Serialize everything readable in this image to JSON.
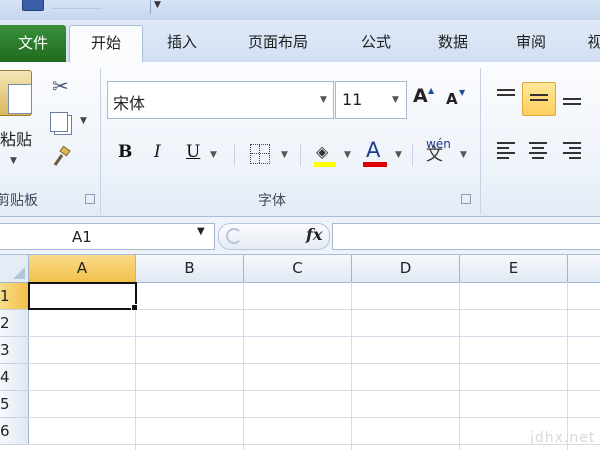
{
  "tabs": {
    "file": "文件",
    "items": [
      "开始",
      "插入",
      "页面布局",
      "公式",
      "数据",
      "审阅",
      "视"
    ]
  },
  "ribbon": {
    "clipboard": {
      "paste_label": "粘贴",
      "group_label": "剪贴板"
    },
    "font": {
      "font_name": "宋体",
      "font_size": "11",
      "grow_label": "A",
      "shrink_label": "A",
      "bold": "B",
      "italic": "I",
      "underline": "U",
      "font_color_label": "A",
      "phonetic_top": "wén",
      "phonetic_char": "文",
      "group_label": "字体"
    }
  },
  "formula_bar": {
    "name_box": "A1",
    "fx_label": "fx",
    "formula": ""
  },
  "grid": {
    "columns": [
      "A",
      "B",
      "C",
      "D",
      "E"
    ],
    "rows": [
      "1",
      "2",
      "3",
      "4",
      "5",
      "6"
    ],
    "active_cell": "A1"
  },
  "watermark": "jdhx.net",
  "colors": {
    "file_tab": "#1f6b1f",
    "selected_header": "#f2c04a",
    "fill_color": "#ffff00",
    "font_color": "#e00000"
  }
}
